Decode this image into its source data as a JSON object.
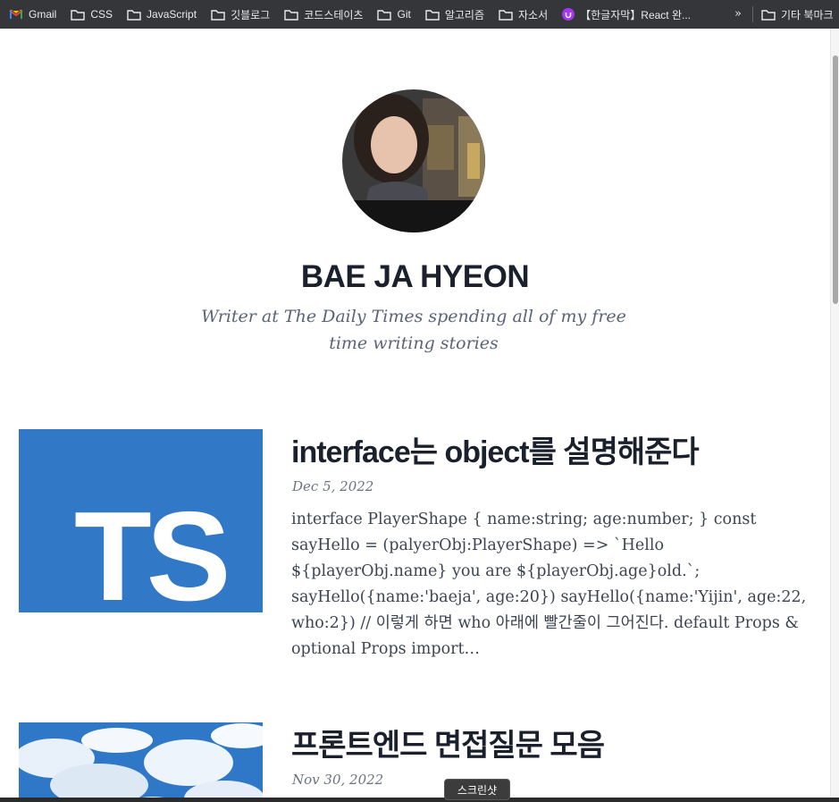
{
  "bookmarks": {
    "items": [
      {
        "label": "Gmail",
        "icon": "gmail-icon"
      },
      {
        "label": "CSS",
        "icon": "folder-icon"
      },
      {
        "label": "JavaScript",
        "icon": "folder-icon"
      },
      {
        "label": "깃블로그",
        "icon": "folder-icon"
      },
      {
        "label": "코드스테이츠",
        "icon": "folder-icon"
      },
      {
        "label": "Git",
        "icon": "folder-icon"
      },
      {
        "label": "알고리즘",
        "icon": "folder-icon"
      },
      {
        "label": "자소서",
        "icon": "folder-icon"
      },
      {
        "label": "【한글자막】React 완...",
        "icon": "udemy-icon"
      }
    ],
    "overflow": "»",
    "other_label": "기타 북마크"
  },
  "profile": {
    "name": "BAE JA HYEON",
    "bio": "Writer at The Daily Times spending all of my free time writing stories"
  },
  "posts": [
    {
      "title": "interface는 object를 설명해준다",
      "date": "Dec 5, 2022",
      "excerpt": "interface PlayerShape { name:string; age:number; } const sayHello = (palyerObj:PlayerShape) => `Hello ${playerObj.name} you are ${playerObj.age}old.`; sayHello({name:'baeja', age:20}) sayHello({name:'Yijin', age:22, who:2}) // 이렇게 하면 who 아래에 빨간줄이 그어진다. default Props & optional Props import…",
      "thumb_text": "TS"
    },
    {
      "title": "프론트엔드 면접질문 모음",
      "date": "Nov 30, 2022"
    }
  ],
  "tooltip": "스크린샷",
  "colors": {
    "ts_blue": "#3178c6",
    "text_dark": "#1a202c"
  }
}
